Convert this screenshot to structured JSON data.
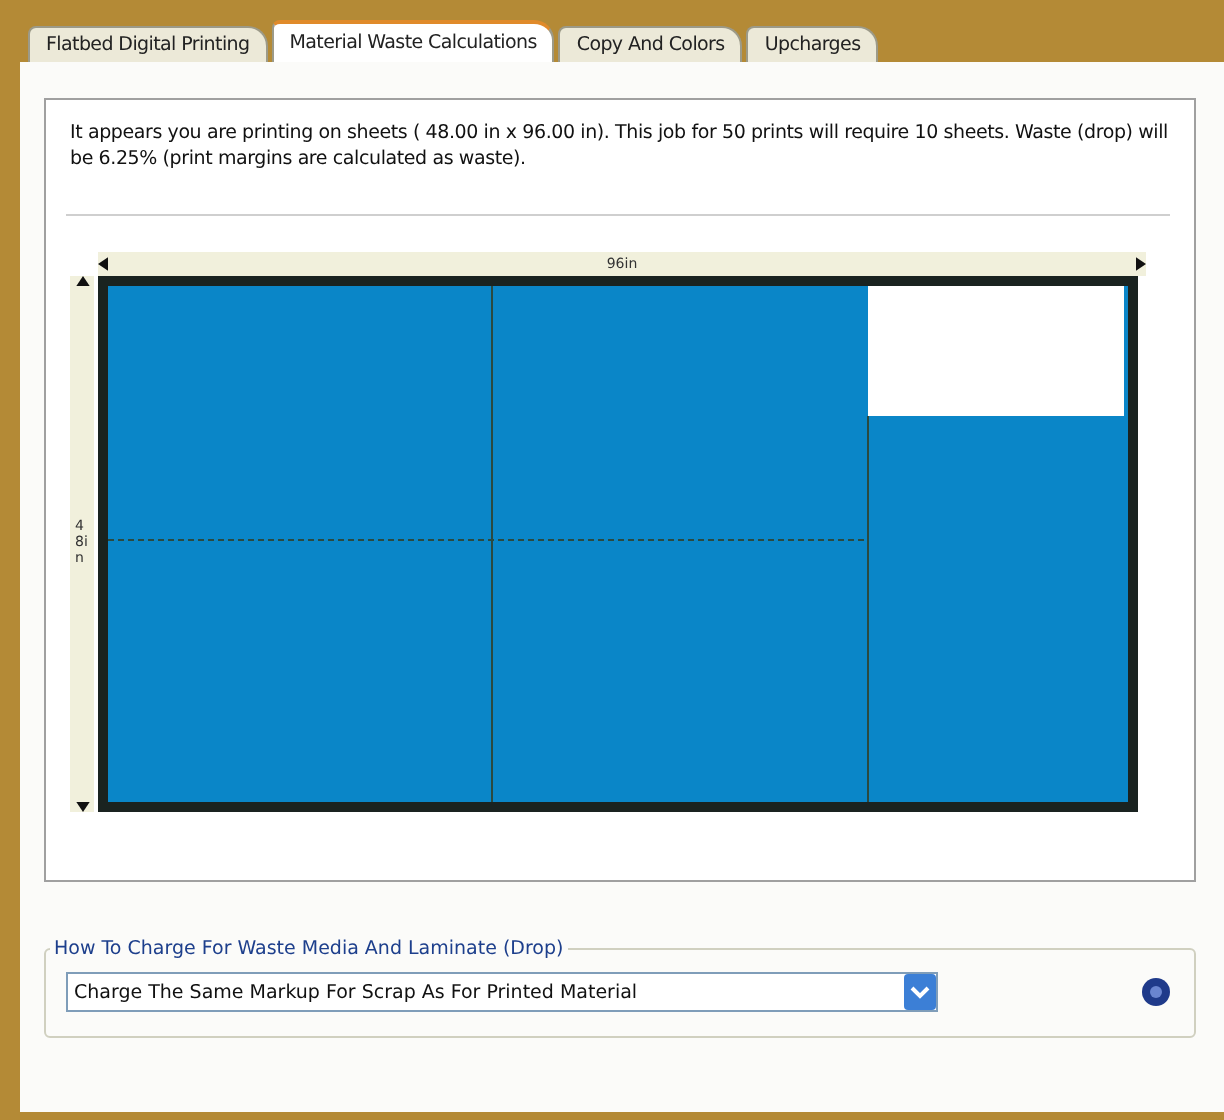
{
  "tabs": [
    {
      "label": "Flatbed Digital Printing",
      "selected": false
    },
    {
      "label": "Material Waste Calculations",
      "selected": true
    },
    {
      "label": "Copy And Colors",
      "selected": false
    },
    {
      "label": "Upcharges",
      "selected": false
    }
  ],
  "message": "It appears you are printing on sheets (   48.00 in x    96.00 in).  This job for 50 prints will require 10 sheets.  Waste (drop) will be 6.25% (print margins are calculated as waste).",
  "layout": {
    "width_label": "96in",
    "height_label": "48in"
  },
  "charge_group": {
    "legend": "How To Charge For Waste Media And Laminate (Drop)",
    "dropdown_value": "Charge The Same Markup For Scrap As For Printed Material"
  }
}
